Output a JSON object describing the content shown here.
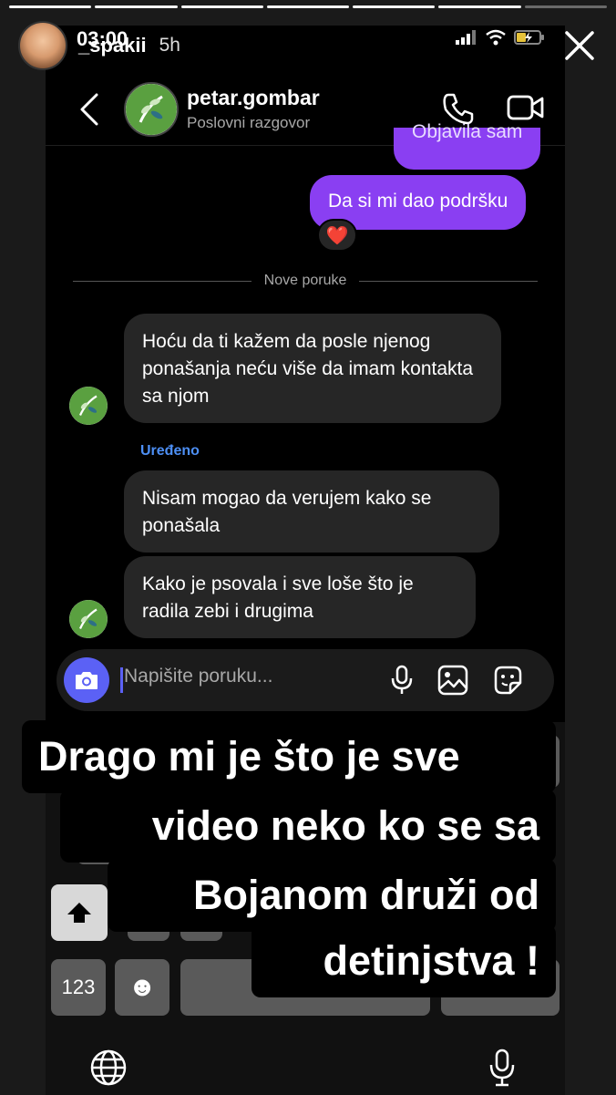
{
  "story": {
    "username": "_spakii",
    "time_ago": "5h",
    "progress_total": 7,
    "progress_done": 6
  },
  "status_bar": {
    "clock": "03:00"
  },
  "chat": {
    "contact_name": "petar.gombar",
    "subtitle": "Poslovni razgovor",
    "messages": [
      {
        "from": "me",
        "text": "Objavila sam"
      },
      {
        "from": "me",
        "text": "Da si mi dao podršku"
      },
      {
        "from": "them",
        "text": "Hoću da ti kažem da posle njenog ponašanja neću više da imam kontakta sa njom"
      },
      {
        "from": "them",
        "text": "Nisam mogao da verujem kako se ponašala"
      },
      {
        "from": "them",
        "text": "Kako je psovala i sve loše što je radila zebi i drugima"
      }
    ],
    "reaction": "❤️",
    "divider_label": "Nove poruke",
    "edited_label": "Uređeno",
    "composer_placeholder": "Napišite poruku..."
  },
  "keyboard": {
    "numbers_key": "123",
    "emoji_key": "☻"
  },
  "caption": {
    "lines": [
      "Drago mi je što je sve",
      "video neko ko se sa",
      "Bojanom druži od",
      "detinjstva !"
    ]
  },
  "colors": {
    "outgoing_bubble": "#8a3ff2",
    "incoming_bubble": "#262626",
    "camera_button": "#5b61f5",
    "edited_text": "#4d8ff5"
  },
  "icons": [
    "close-icon",
    "back-icon",
    "phone-icon",
    "video-call-icon",
    "camera-icon",
    "microphone-icon",
    "image-icon",
    "sticker-icon",
    "shift-icon",
    "emoji-icon",
    "globe-icon",
    "dictation-icon",
    "signal-icon",
    "wifi-icon",
    "battery-icon"
  ]
}
